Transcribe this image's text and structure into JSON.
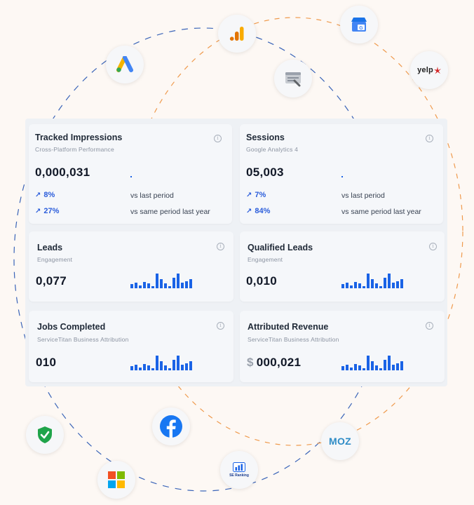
{
  "colors": {
    "accent": "#1a63e6",
    "orbit_blue": "#3a64b8",
    "orbit_orange": "#ef9a4d",
    "background": "#fdf8f4"
  },
  "integrations": [
    {
      "name": "google-ads-icon"
    },
    {
      "name": "google-analytics-icon"
    },
    {
      "name": "google-business-profile-icon"
    },
    {
      "name": "google-search-console-icon"
    },
    {
      "name": "yelp-icon",
      "label": "yelp"
    },
    {
      "name": "security-shield-icon"
    },
    {
      "name": "facebook-icon"
    },
    {
      "name": "microsoft-icon"
    },
    {
      "name": "se-ranking-icon",
      "label": "SE Ranking"
    },
    {
      "name": "moz-icon",
      "label": "MOZ"
    }
  ],
  "cards": [
    {
      "title": "Tracked Impressions",
      "subtitle": "Cross-Platform Performance",
      "value": "0,000,031",
      "trends": [
        {
          "pct": "8%",
          "label": "vs last period"
        },
        {
          "pct": "27%",
          "label": "vs same period last year"
        }
      ]
    },
    {
      "title": "Sessions",
      "subtitle": "Google Analytics 4",
      "value": "05,003",
      "trends": [
        {
          "pct": "7%",
          "label": "vs last period"
        },
        {
          "pct": "84%",
          "label": "vs same period last year"
        }
      ]
    },
    {
      "title": "Leads",
      "subtitle": "Engagement",
      "value": "0,077"
    },
    {
      "title": "Qualified Leads",
      "subtitle": "Engagement",
      "value": "0,010"
    },
    {
      "title": "Jobs Completed",
      "subtitle": "ServiceTitan Business Attribution",
      "value": "010"
    },
    {
      "title": "Attributed Revenue",
      "subtitle": "ServiceTitan Business Attribution",
      "value": "000,021",
      "currency": "$"
    }
  ],
  "sparkline": [
    0.25,
    0.35,
    0.2,
    0.4,
    0.3,
    0.15,
    0.95,
    0.6,
    0.3,
    0.15,
    0.7,
    0.95,
    0.35,
    0.45,
    0.6
  ]
}
